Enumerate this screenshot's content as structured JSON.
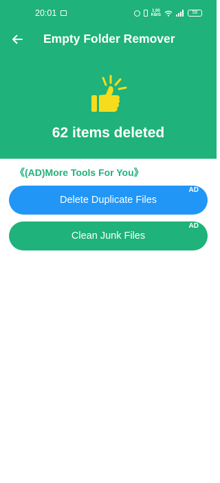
{
  "status_bar": {
    "time": "20:01",
    "net_speed_value": "1.00",
    "net_speed_unit": "KB/S",
    "battery": "56",
    "icons": [
      "message-icon",
      "alarm-icon",
      "vibrate-icon",
      "wifi-icon",
      "signal-icon",
      "battery-icon"
    ]
  },
  "header": {
    "title": "Empty Folder Remover",
    "back_icon": "arrow-left-icon",
    "result_icon": "thumbs-up-icon",
    "result_text": "62 items deleted",
    "items_deleted": 62
  },
  "tools": {
    "heading": "《(AD)More Tools For You》",
    "buttons": [
      {
        "label": "Delete Duplicate Files",
        "badge": "AD",
        "color": "#2196f7"
      },
      {
        "label": "Clean Junk Files",
        "badge": "AD",
        "color": "#1fb27a"
      }
    ]
  },
  "colors": {
    "brand_green": "#1fb27a",
    "accent_blue": "#2196f7",
    "thumb_yellow": "#f5dd1e"
  }
}
